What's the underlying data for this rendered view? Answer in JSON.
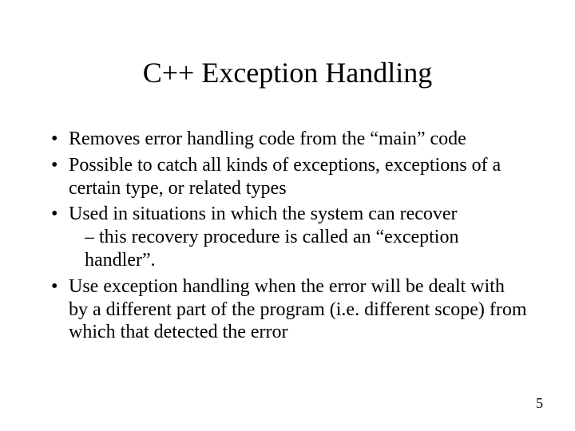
{
  "slide": {
    "title": "C++ Exception Handling",
    "bullets": [
      {
        "text": "Removes error handling code from the “main” code"
      },
      {
        "text": "Possible to catch all kinds of exceptions, exceptions of a certain type, or related types"
      },
      {
        "text": "Used in situations in which the system can recover",
        "sub": "– this recovery procedure is called an “exception handler”."
      },
      {
        "text": "Use exception handling when the error will be dealt with by a different part of the program (i.e. different scope) from which that detected the error"
      }
    ],
    "page_number": "5"
  }
}
